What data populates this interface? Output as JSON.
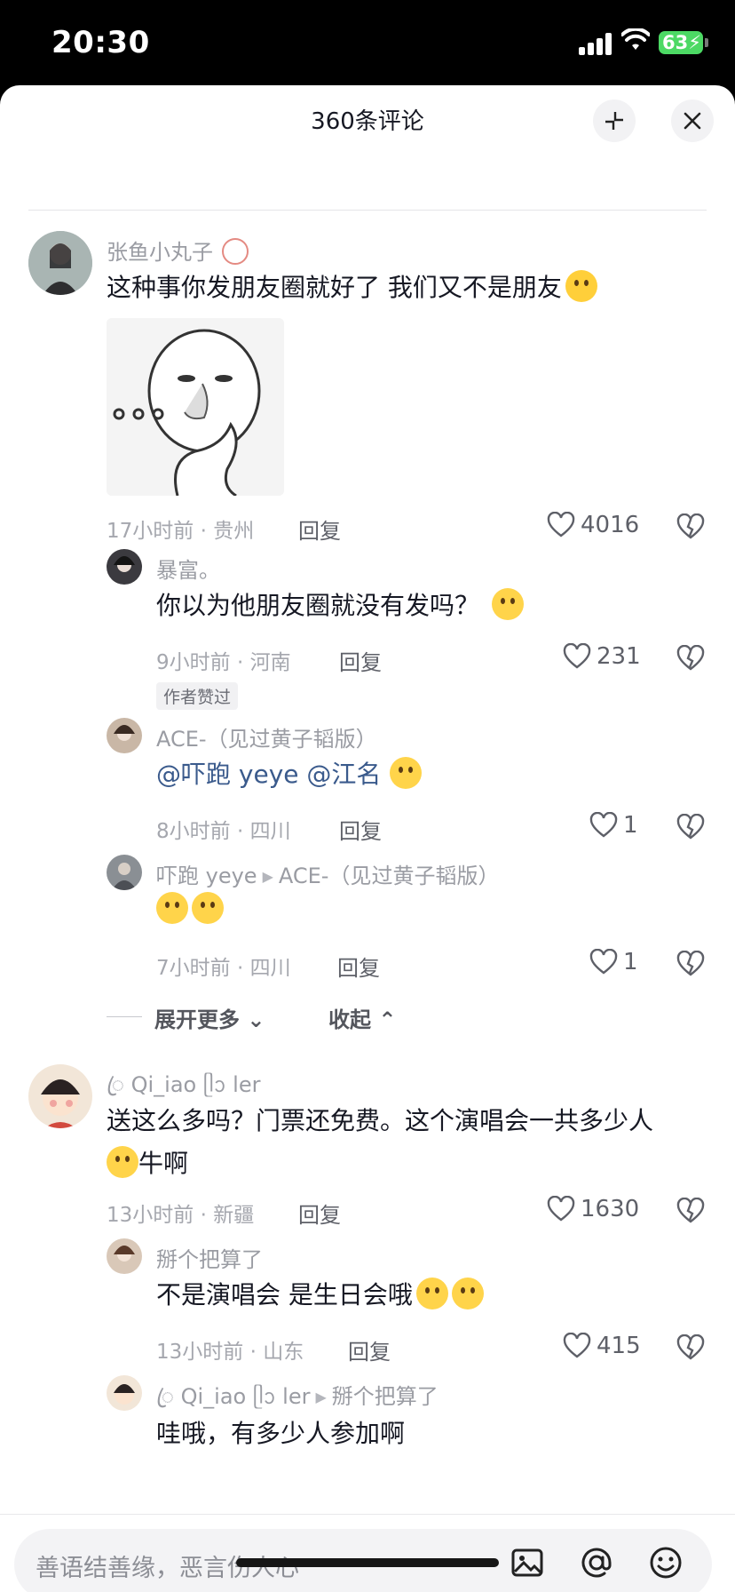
{
  "status_bar": {
    "time": "20:30",
    "battery": "63"
  },
  "sheet": {
    "title": "360条评论",
    "input_placeholder": "善语结善缘，恶言伤人心"
  },
  "comments": [
    {
      "user": "张鱼小丸子",
      "text": "这种事你发朋友圈就好了 我们又不是朋友",
      "meta": "17小时前 · 贵州",
      "reply_label": "回复",
      "likes": "4016",
      "emoji": "crying-emoji"
    },
    {
      "user": "暴富。",
      "text": "你以为他朋友圈就没有发吗？",
      "meta": "9小时前 · 河南",
      "reply_label": "回复",
      "likes": "231",
      "badge": "作者赞过",
      "emoji": "wink-tongue-emoji"
    },
    {
      "user": "ACE-（见过黄子韬版）",
      "mention1": "@吓跑 yeye",
      "mention2": "@江名",
      "meta": "8小时前 · 四川",
      "reply_label": "回复",
      "likes": "1",
      "emoji": "pleading-emoji"
    },
    {
      "user": "吓跑 yeye",
      "reply_to": "ACE-（见过黄子韬版）",
      "meta": "7小时前 · 四川",
      "reply_label": "回复",
      "likes": "1",
      "emoji": "shocked-emoji"
    },
    {
      "user": "ꦿ Qi_iao ᥫᩣ ler",
      "text": "送这么多吗？门票还免费。这个演唱会一共多少人",
      "text2": "牛啊",
      "meta": "13小时前 · 新疆",
      "reply_label": "回复",
      "likes": "1630",
      "emoji": "laughing-tears-emoji"
    },
    {
      "user": "掰个把算了",
      "text": "不是演唱会 是生日会哦",
      "meta": "13小时前 · 山东",
      "reply_label": "回复",
      "likes": "415",
      "emoji": "grin-emoji"
    },
    {
      "user": "ꦿ Qi_iao ᥫᩣ ler",
      "reply_to": "掰个把算了",
      "text": "哇哦，有多少人参加啊"
    }
  ],
  "thread_controls": {
    "expand": "展开更多",
    "collapse": "收起"
  }
}
